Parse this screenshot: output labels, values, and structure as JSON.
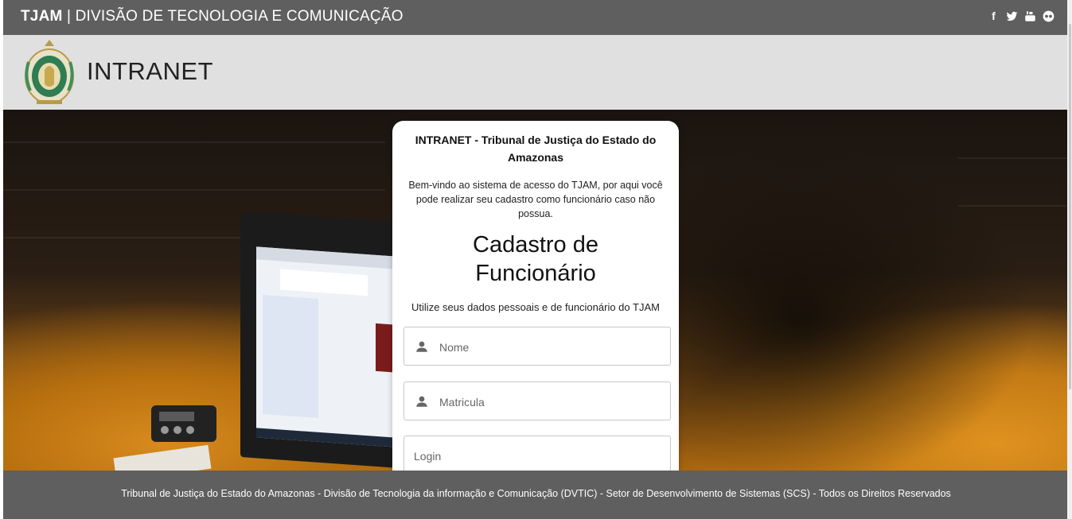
{
  "topbar": {
    "brand_bold": "TJAM",
    "separator": " | ",
    "brand_rest": "DIVISÃO DE TECNOLOGIA E COMUNICAÇÃO",
    "social": [
      {
        "icon": "facebook-icon",
        "glyph": "f"
      },
      {
        "icon": "twitter-icon"
      },
      {
        "icon": "youtube-icon"
      },
      {
        "icon": "flickr-icon"
      }
    ]
  },
  "header": {
    "logo_icon": "tjam-coat-of-arms-logo",
    "title": "INTRANET"
  },
  "card": {
    "title": "INTRANET - Tribunal de Justiça do Estado do Amazonas",
    "welcome": "Bem-vindo ao sistema de acesso do TJAM, por aqui você pode realizar seu cadastro como funcionário caso não possua.",
    "heading_line1": "Cadastro de",
    "heading_line2": "Funcionário",
    "subtitle": "Utilize seus dados pessoais e de funcionário do TJAM",
    "fields": {
      "nome": {
        "placeholder": "Nome",
        "icon": "person-icon"
      },
      "matricula": {
        "placeholder": "Matricula",
        "icon": "person-icon"
      },
      "login": {
        "placeholder": "Login"
      }
    }
  },
  "footer": {
    "text": "Tribunal de Justiça do Estado do Amazonas - Divisão de Tecnologia da informação e Comunicação (DVTIC) - Setor de Desenvolvimento de Sistemas (SCS) - Todos os Direitos Reservados"
  },
  "colors": {
    "topbar_bg": "#5f5f5f",
    "header_bg": "#e0e0e0",
    "footer_bg": "#5f5f5f",
    "card_bg": "#ffffff"
  }
}
